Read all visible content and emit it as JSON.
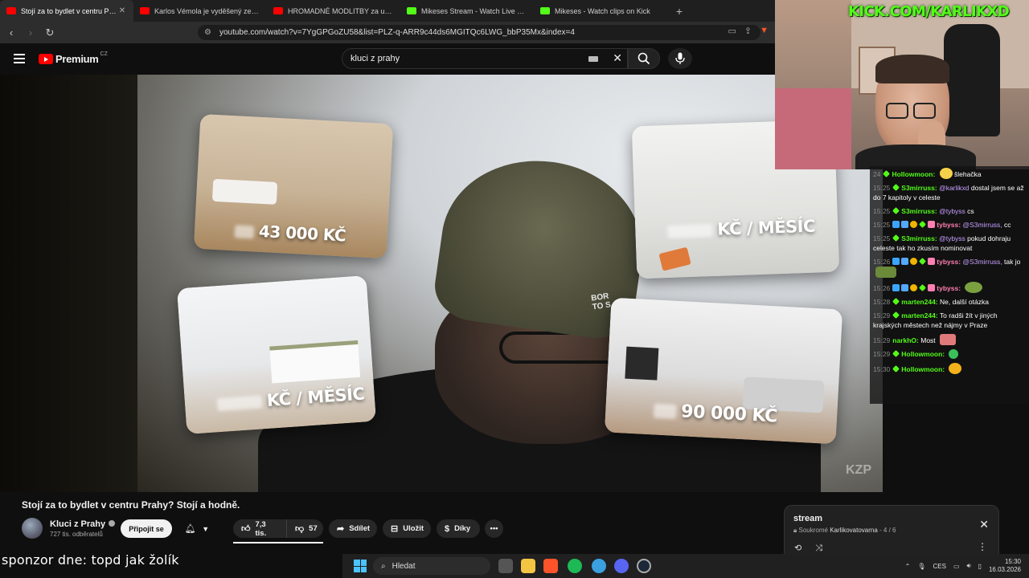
{
  "browser": {
    "tabs": [
      {
        "label": "Stojí za to bydlet v centru Prahy",
        "active": true,
        "icon": "youtube-icon"
      },
      {
        "label": "Karlos Vémola je vyděšený ze svého",
        "active": false,
        "icon": "youtube-icon"
      },
      {
        "label": "HROMADNÉ MODLITBY za uzdraven",
        "active": false,
        "icon": "youtube-icon"
      },
      {
        "label": "Mikeses Stream - Watch Live on Kick",
        "active": false,
        "icon": "kick-icon"
      },
      {
        "label": "Mikeses - Watch clips on Kick",
        "active": false,
        "icon": "kick-icon"
      }
    ],
    "url": "youtube.com/watch?v=7YgGPGoZU58&list=PLZ-q-ARR9c44ds6MGITQc6LWG_bbP35Mx&index=4"
  },
  "youtube": {
    "brand": "Premium",
    "region": "CZ",
    "search_query": "kluci z prahy"
  },
  "video": {
    "cards": [
      {
        "price": "43 000 KČ"
      },
      {
        "price": "KČ / MĚSÍC"
      },
      {
        "price": "KČ / MĚSÍC"
      },
      {
        "price": "90 000 KČ"
      }
    ],
    "hat_text": "BOR\nTO S",
    "watermark": "KZP",
    "title": "Stojí za to bydlet v centru Prahy? Stojí a hodně.",
    "channel_name": "Kluci z Prahy",
    "subscribers": "727 tis. odběratelů",
    "join_label": "Připojit se",
    "likes": "7,3 tis.",
    "dislikes": "57",
    "share_label": "Sdílet",
    "save_label": "Uložit",
    "thanks_label": "Díky"
  },
  "stream_overlay": {
    "kick_url": "KICK.COM/KARLIKXD",
    "sponsor": "sponzor dne: topd jak žolík"
  },
  "chat": [
    {
      "ts": "24",
      "user": "Hollowmoon:",
      "color": "#53fc18",
      "text": "šlehačka",
      "emote": true
    },
    {
      "ts": "15:25",
      "user": "S3mirruss:",
      "color": "#53fc18",
      "mention": "@karlikxd",
      "text": "dostal jsem se až do 7 kapitoly v celeste"
    },
    {
      "ts": "15:25",
      "user": "S3mirruss:",
      "color": "#53fc18",
      "mention": "@tybyss",
      "text": "cs"
    },
    {
      "ts": "15:25",
      "user": "tybyss:",
      "color": "#ff7fb2",
      "mention": "@S3mirruss,",
      "text": "cc",
      "badges": true
    },
    {
      "ts": "15:25",
      "user": "S3mirruss:",
      "color": "#53fc18",
      "mention": "@tybyss",
      "text": "pokud dohraju celeste tak ho zkusím nominovat"
    },
    {
      "ts": "15:26",
      "user": "tybyss:",
      "color": "#ff7fb2",
      "mention": "@S3mirruss,",
      "text": "tak jo",
      "badges": true,
      "emote": true
    },
    {
      "ts": "15:26",
      "user": "tybyss:",
      "color": "#ff7fb2",
      "text": "",
      "badges": true,
      "emote": true
    },
    {
      "ts": "15:28",
      "user": "marten244:",
      "color": "#53fc18",
      "text": "Ne, další otázka"
    },
    {
      "ts": "15:29",
      "user": "marten244:",
      "color": "#53fc18",
      "text": "To radši žít v jiných krajských městech než nájmy v Praze"
    },
    {
      "ts": "15:29",
      "user": "narkhO:",
      "color": "#53fc18",
      "text": "Most",
      "emote": true
    },
    {
      "ts": "15:29",
      "user": "Hollowmoon:",
      "color": "#53fc18",
      "text": "",
      "emote": true
    },
    {
      "ts": "15:30",
      "user": "Hollowmoon:",
      "color": "#53fc18",
      "text": "",
      "emote": true
    }
  ],
  "playlist": {
    "title": "stream",
    "privacy": "Soukromé",
    "owner": "Karlikovatovarna",
    "position": "4 / 6"
  },
  "taskbar": {
    "search_placeholder": "Hledat",
    "lang": "CES",
    "time": "15:30",
    "date": "16.03.2026"
  }
}
